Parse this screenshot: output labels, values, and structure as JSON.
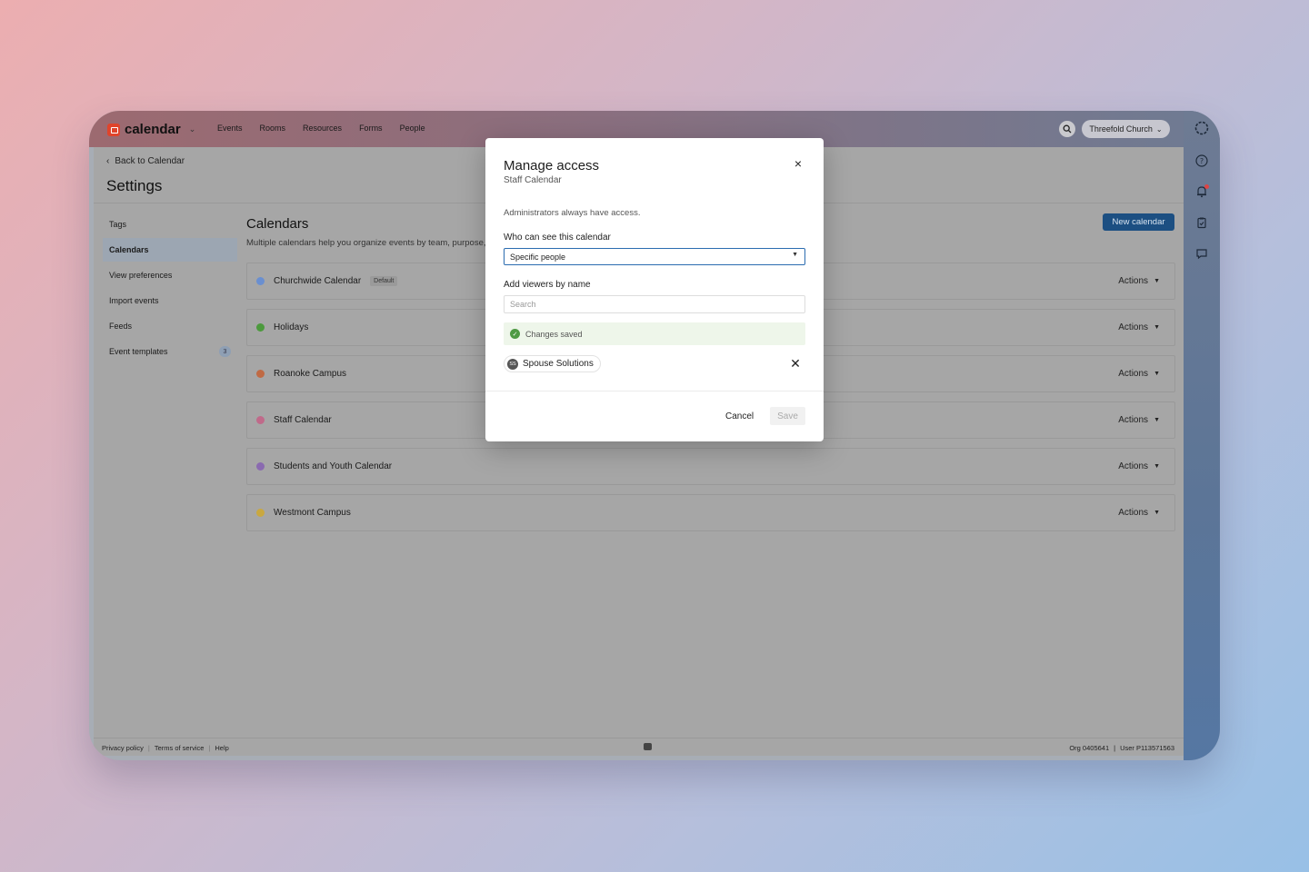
{
  "app": {
    "name": "calendar",
    "nav": [
      "Events",
      "Rooms",
      "Resources",
      "Forms",
      "People"
    ],
    "org_switch_label": "Threefold Church"
  },
  "page": {
    "back_label": "Back to Calendar",
    "title": "Settings"
  },
  "sidebar": {
    "items": [
      {
        "label": "Tags",
        "active": false
      },
      {
        "label": "Calendars",
        "active": true
      },
      {
        "label": "View preferences",
        "active": false
      },
      {
        "label": "Import events",
        "active": false
      },
      {
        "label": "Feeds",
        "active": false
      },
      {
        "label": "Event templates",
        "active": false,
        "badge": "3"
      }
    ]
  },
  "main": {
    "title": "Calendars",
    "subtitle": "Multiple calendars help you organize events by team, purpose, or location.",
    "new_button": "New calendar",
    "calendars": [
      {
        "name": "Churchwide Calendar",
        "color": "#6a8fd0",
        "badge": "Default",
        "actions": "Actions"
      },
      {
        "name": "Holidays",
        "color": "#4c9a3d",
        "actions": "Actions"
      },
      {
        "name": "Roanoke Campus",
        "color": "#c06a44",
        "actions": "Actions"
      },
      {
        "name": "Staff Calendar",
        "color": "#c06a8a",
        "actions": "Actions"
      },
      {
        "name": "Students and Youth Calendar",
        "color": "#8a6ab0",
        "actions": "Actions"
      },
      {
        "name": "Westmont Campus",
        "color": "#c9a840",
        "actions": "Actions"
      }
    ]
  },
  "footer": {
    "links": [
      "Privacy policy",
      "Terms of service",
      "Help"
    ],
    "org": "Org 0405641",
    "user": "User P113571563"
  },
  "modal": {
    "title": "Manage access",
    "subtitle": "Staff Calendar",
    "note": "Administrators always have access.",
    "who_label": "Who can see this calendar",
    "who_value": "Specific people",
    "add_label": "Add viewers by name",
    "search_placeholder": "Search",
    "saved_message": "Changes saved",
    "viewer": {
      "initials": "SS",
      "name": "Spouse Solutions"
    },
    "cancel_label": "Cancel",
    "save_label": "Save"
  }
}
